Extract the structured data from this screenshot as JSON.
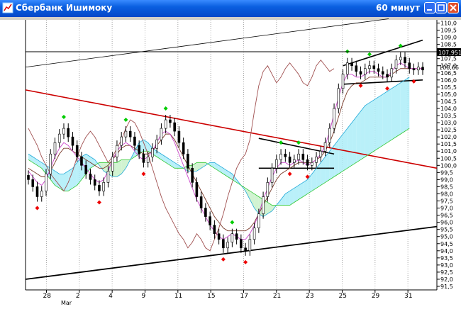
{
  "window": {
    "title": "Сбербанк Ишимоку",
    "timeframe": "60 минут"
  },
  "price_axis": {
    "labels": [
      "110,0",
      "109,5",
      "109,0",
      "108,5",
      "108,0",
      "107,5",
      "107,0",
      "106,5",
      "106,0",
      "105,5",
      "105,0",
      "104,5",
      "104,0",
      "103,5",
      "103,0",
      "102,5",
      "102,0",
      "101,5",
      "101,0",
      "100,5",
      "100,0",
      "99,5",
      "99,0",
      "98,5",
      "98,0",
      "97,5",
      "97,0",
      "96,5",
      "96,0",
      "95,5",
      "95,0",
      "94,5",
      "94,0",
      "93,5",
      "93,0",
      "92,5",
      "92,0",
      "91,5"
    ],
    "last_price": "107,951",
    "current_tag": "106,66"
  },
  "time_axis": {
    "labels": [
      "28",
      "2",
      "4",
      "9",
      "11",
      "15",
      "17",
      "21",
      "23",
      "25",
      "29",
      "31"
    ],
    "month": "Mar"
  },
  "colors": {
    "candle": "#000000",
    "tenkan": "#cc44cc",
    "kijun": "#7a3a2a",
    "cloud_up": "#30c830",
    "cloud_down": "#20a8d8",
    "trend_red": "#cc0000",
    "marker_up": "#00cc00",
    "marker_down": "#ee0000"
  },
  "chart_data": {
    "type": "candlestick",
    "title": "",
    "ylim": [
      91.5,
      110.0
    ],
    "close": [
      99.0,
      98.5,
      97.8,
      98.2,
      99.4,
      100.8,
      101.6,
      102.2,
      102.6,
      102.0,
      101.4,
      100.6,
      100.0,
      99.4,
      99.0,
      98.6,
      98.2,
      98.8,
      99.6,
      100.6,
      101.4,
      102.0,
      102.4,
      102.0,
      101.4,
      100.8,
      100.2,
      100.6,
      101.2,
      101.8,
      102.6,
      103.2,
      103.0,
      102.4,
      101.6,
      100.8,
      99.8,
      98.8,
      97.8,
      97.0,
      96.4,
      95.8,
      95.2,
      94.8,
      94.2,
      94.6,
      95.2,
      94.8,
      94.2,
      94.0,
      94.8,
      95.6,
      96.6,
      97.8,
      98.8,
      99.8,
      100.4,
      100.8,
      100.6,
      100.2,
      100.4,
      100.8,
      100.4,
      100.0,
      100.2,
      100.6,
      101.0,
      101.6,
      102.6,
      104.0,
      105.4,
      106.4,
      107.2,
      107.0,
      106.6,
      106.4,
      106.8,
      107.0,
      106.8,
      106.6,
      106.4,
      106.2,
      106.8,
      107.4,
      107.6,
      107.2,
      106.8,
      106.7,
      106.9,
      106.7
    ],
    "tenkan_sen": [
      99.6,
      99.2,
      98.8,
      98.6,
      99.0,
      99.8,
      100.6,
      101.2,
      101.6,
      101.4,
      101.0,
      100.6,
      100.2,
      99.8,
      99.4,
      99.0,
      98.8,
      99.0,
      99.6,
      100.4,
      101.0,
      101.4,
      101.6,
      101.4,
      101.0,
      100.6,
      100.4,
      100.6,
      101.0,
      101.6,
      102.2,
      102.4,
      102.2,
      101.6,
      100.8,
      100.0,
      99.2,
      98.4,
      97.6,
      97.0,
      96.4,
      95.8,
      95.4,
      95.0,
      94.8,
      95.0,
      95.2,
      95.0,
      94.8,
      94.8,
      95.2,
      95.8,
      96.6,
      97.6,
      98.4,
      99.2,
      99.8,
      100.2,
      100.2,
      100.0,
      100.2,
      100.4,
      100.2,
      100.0,
      100.2,
      100.4,
      100.8,
      101.4,
      102.4,
      103.6,
      104.8,
      105.8,
      106.4,
      106.4,
      106.2,
      106.2,
      106.4,
      106.6,
      106.6,
      106.4,
      106.2,
      106.2,
      106.6,
      107.0,
      107.2,
      107.0,
      106.8,
      106.8,
      106.8,
      106.8
    ],
    "kijun_sen": [
      99.8,
      99.6,
      99.4,
      99.2,
      99.2,
      99.6,
      100.2,
      100.8,
      101.2,
      101.2,
      101.0,
      100.8,
      100.6,
      100.4,
      100.2,
      100.0,
      99.8,
      99.8,
      100.0,
      100.4,
      100.8,
      101.2,
      101.4,
      101.4,
      101.2,
      101.0,
      100.8,
      100.8,
      101.0,
      101.4,
      101.8,
      102.2,
      102.2,
      101.8,
      101.2,
      100.6,
      100.0,
      99.4,
      98.8,
      98.2,
      97.6,
      97.0,
      96.4,
      96.0,
      95.6,
      95.4,
      95.4,
      95.4,
      95.4,
      95.4,
      95.6,
      96.0,
      96.6,
      97.2,
      97.8,
      98.4,
      99.0,
      99.4,
      99.6,
      99.8,
      100.0,
      100.2,
      100.2,
      100.2,
      100.2,
      100.4,
      100.6,
      101.0,
      101.6,
      102.4,
      103.4,
      104.4,
      105.2,
      105.6,
      105.8,
      105.8,
      106.0,
      106.2,
      106.2,
      106.2,
      106.2,
      106.2,
      106.4,
      106.6,
      106.8,
      106.8,
      106.8,
      106.8,
      106.8,
      106.8
    ],
    "chikou_span": [
      102.6,
      102.0,
      101.4,
      100.6,
      100.0,
      99.4,
      99.0,
      98.6,
      98.2,
      98.8,
      99.6,
      100.6,
      101.4,
      102.0,
      102.4,
      102.0,
      101.4,
      100.8,
      100.2,
      100.6,
      101.2,
      101.8,
      102.6,
      103.2,
      103.0,
      102.4,
      101.6,
      100.8,
      99.8,
      98.8,
      97.8,
      97.0,
      96.4,
      95.8,
      95.2,
      94.8,
      94.2,
      94.6,
      95.2,
      94.8,
      94.2,
      94.0,
      94.8,
      95.6,
      96.6,
      97.8,
      98.8,
      99.8,
      100.4,
      100.8,
      101.8,
      103.8,
      105.6,
      106.6,
      107.0,
      106.4,
      105.8,
      106.2,
      106.8,
      107.2,
      106.8,
      106.4,
      105.8,
      105.6,
      106.2,
      107.0,
      107.4,
      107.0,
      106.6,
      106.8
    ],
    "senkou_span_a": [
      100.8,
      100.6,
      100.4,
      100.2,
      100.0,
      99.8,
      99.6,
      99.4,
      99.4,
      99.6,
      99.8,
      100.2,
      100.6,
      100.8,
      100.6,
      100.4,
      100.0,
      99.6,
      99.4,
      99.2,
      99.2,
      99.4,
      99.8,
      100.4,
      101.0,
      101.6,
      101.8,
      101.6,
      101.2,
      101.0,
      100.8,
      100.6,
      100.4,
      100.2,
      100.0,
      99.8,
      99.6,
      99.6,
      99.6,
      99.8,
      100.0,
      100.2,
      100.2,
      100.0,
      99.8,
      99.6,
      99.4,
      99.0,
      98.6,
      98.2,
      97.6,
      97.0,
      96.6,
      96.4,
      96.6,
      96.8,
      97.2,
      97.6,
      98.0,
      98.2,
      98.4,
      98.6,
      98.8,
      99.0,
      99.4,
      99.8,
      100.2,
      100.6,
      101.0,
      101.4,
      101.8,
      102.2,
      102.6,
      103.0,
      103.4,
      103.8,
      104.2,
      104.4,
      104.6,
      104.8,
      105.0,
      105.2,
      105.4,
      105.6,
      105.8,
      106.0,
      106.2
    ],
    "senkou_span_b": [
      100.4,
      100.2,
      100.0,
      99.8,
      99.4,
      99.0,
      98.6,
      98.4,
      98.2,
      98.2,
      98.4,
      98.6,
      99.0,
      99.4,
      99.8,
      100.0,
      100.2,
      100.2,
      100.2,
      100.2,
      100.2,
      100.4,
      100.4,
      100.4,
      100.6,
      100.8,
      101.0,
      101.0,
      100.8,
      100.6,
      100.4,
      100.2,
      100.0,
      99.8,
      99.8,
      99.8,
      100.0,
      100.0,
      100.2,
      100.2,
      100.2,
      100.0,
      99.8,
      99.6,
      99.4,
      99.2,
      99.0,
      98.8,
      98.6,
      98.4,
      98.2,
      98.0,
      97.8,
      97.6,
      97.4,
      97.2,
      97.2,
      97.2,
      97.2,
      97.2,
      97.4,
      97.6,
      97.8,
      98.0,
      98.2,
      98.4,
      98.6,
      98.8,
      99.0,
      99.2,
      99.4,
      99.6,
      99.8,
      100.0,
      100.2,
      100.4,
      100.6,
      100.8,
      101.0,
      101.2,
      101.4,
      101.6,
      101.8,
      102.0,
      102.2,
      102.4,
      102.6
    ]
  }
}
